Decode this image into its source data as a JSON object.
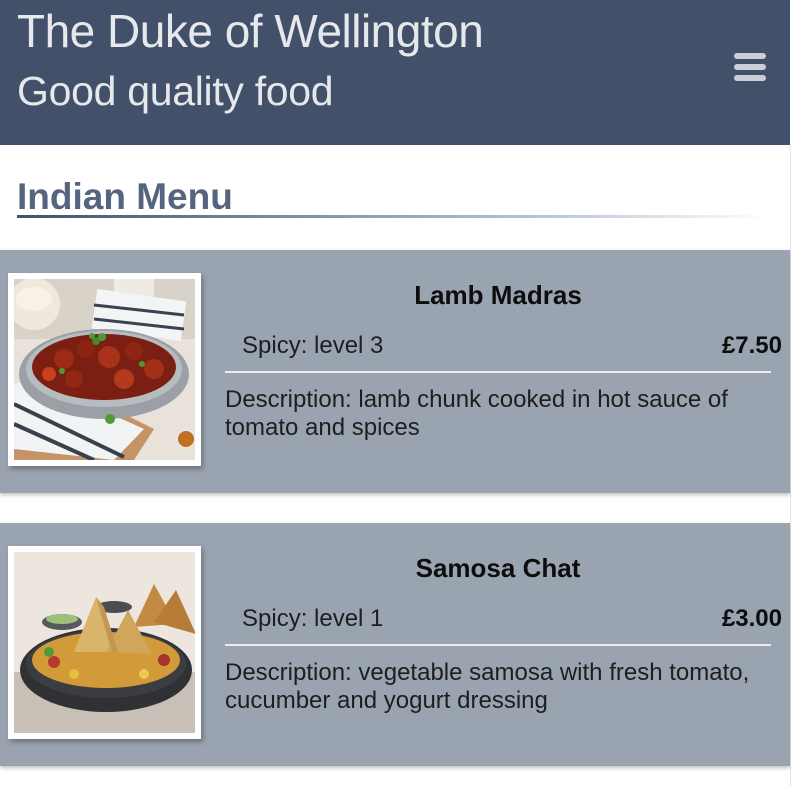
{
  "header": {
    "title": "The Duke of Wellington",
    "tagline": "Good quality food",
    "menu_icon": "hamburger-menu-icon",
    "bg_color": "#435069"
  },
  "section": {
    "title": "Indian Menu"
  },
  "dishes": [
    {
      "name": "Lamb Madras",
      "spicy": "Spicy: level 3",
      "price": "£7.50",
      "description": "Description: lamb chunk cooked in hot sauce of tomato and spices",
      "image": "lamb-madras-photo"
    },
    {
      "name": "Samosa Chat",
      "spicy": "Spicy: level 1",
      "price": "£3.00",
      "description": "Description: vegetable samosa with fresh tomato, cucumber and yogurt dressing",
      "image": "samosa-chat-photo"
    }
  ],
  "colors": {
    "card_bg": "#9aa4b1",
    "section_title": "#55647f"
  }
}
